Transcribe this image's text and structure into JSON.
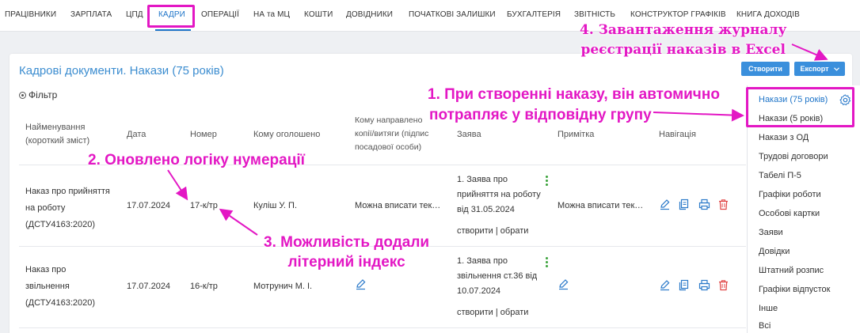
{
  "topnav": {
    "items": [
      "ПРАЦІВНИКИ",
      "ЗАРПЛАТА",
      "ЦПД",
      "КАДРИ",
      "ОПЕРАЦІЇ",
      "НА та МЦ",
      "КОШТИ",
      "ДОВІДНИКИ",
      "ПОЧАТКОВІ ЗАЛИШКИ",
      "БУХГАЛТЕРІЯ",
      "ЗВІТНІСТЬ",
      "КОНСТРУКТОР ГРАФІКІВ",
      "КНИГА ДОХОДІВ"
    ],
    "active_index": 3
  },
  "page": {
    "title": "Кадрові документи. Накази (75 років)",
    "filter_label": "Фільтр",
    "create_button": "Створити",
    "export_button": "Експорт"
  },
  "table": {
    "headers": {
      "name_line1": "Найменування",
      "name_line2": "(короткий зміст)",
      "date": "Дата",
      "number": "Номер",
      "announced": "Кому оголошено",
      "sent_line1": "Кому направлено",
      "sent_line2": "копії/витяги (підпис",
      "sent_line3": "посадової особи)",
      "application": "Заява",
      "note": "Примітка",
      "navigation": "Навігація"
    },
    "rows": [
      {
        "name1": "Наказ про прийняття",
        "name2": "на роботу",
        "name3": "(ДСТУ4163:2020)",
        "date": "17.07.2024",
        "number": "17-к/тр",
        "announced": "Куліш У. П.",
        "sent": "Можна вписати тек…",
        "app1": "1. Заява про",
        "app2": "прийняття на роботу",
        "app3": "від 31.05.2024",
        "app_links": "створити | обрати",
        "note": "Можна вписати тек…"
      },
      {
        "name1": "Наказ про",
        "name2": "звільнення",
        "name3": "(ДСТУ4163:2020)",
        "date": "17.07.2024",
        "number": "16-к/тр",
        "announced": "Мотрунич М. І.",
        "sent": "",
        "app1": "1. Заява про",
        "app2": "звільнення ст.36 від",
        "app3": "10.07.2024",
        "app_links": "створити | обрати",
        "note": ""
      }
    ]
  },
  "sidebar": {
    "items": [
      "Накази (75 років)",
      "Накази (5 років)",
      "Накази з ОД",
      "Трудові договори",
      "Табелі П-5",
      "Графіки роботи",
      "Особові картки",
      "Заяви",
      "Довідки",
      "Штатний розпис",
      "Графіки відпусток",
      "Інше",
      "Всі"
    ],
    "active_index": 0
  },
  "annotations": {
    "a1_line1": "1. При створенні наказу, він автомично",
    "a1_line2": "потрапляє у відповідну групу",
    "a2": "2. Оновлено логіку нумерації",
    "a3_line1": "3. Можливість додали",
    "a3_line2": "літерний індекс",
    "a4_line1": "4. Завантаження журналу",
    "a4_line2": "реєстрації наказів в Excel"
  },
  "colors": {
    "accent": "#1e74c8",
    "button": "#3a8fdc",
    "annotation": "#e317c4",
    "icon_blue": "#2a79c9",
    "icon_red": "#e04545",
    "kebab_green": "#3aa23a"
  },
  "icons": [
    "settings-icon",
    "edit-icon",
    "copy-icon",
    "print-icon",
    "trash-icon",
    "chevron-down-icon",
    "filter-icon",
    "kebab-icon"
  ]
}
